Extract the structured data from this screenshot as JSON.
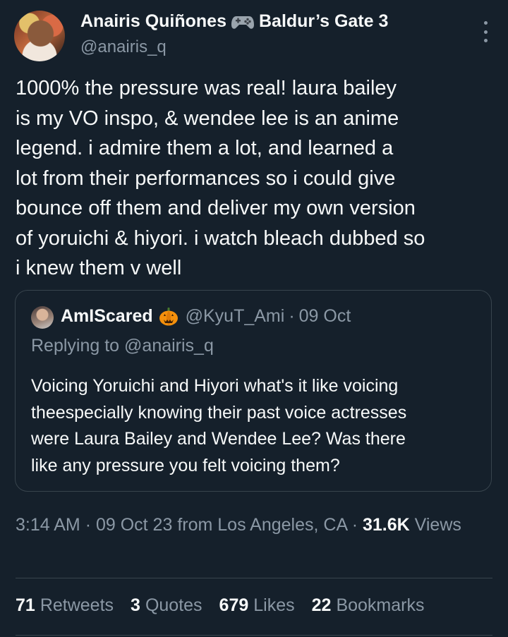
{
  "author": {
    "name": "Anairis Quiñones",
    "game_label": "Baldur’s Gate 3",
    "handle": "@anairis_q"
  },
  "tweet": {
    "text": "1000% the pressure was real! laura bailey\nis my VO inspo, & wendee lee is an anime\nlegend. i admire them a lot, and learned a\nlot from their performances so i could give\nbounce off them and deliver my own version\nof yoruichi & hiyori. i watch bleach dubbed so\ni knew them v well"
  },
  "quoted": {
    "name": "AmIScared",
    "handle": "@KyuT_Ami",
    "separator": "·",
    "date": "09 Oct",
    "replying_prefix": "Replying to",
    "replying_to": "@anairis_q",
    "text": "Voicing Yoruichi and Hiyori what's it like voicing\ntheespecially knowing their past voice actresses\nwere Laura Bailey and Wendee Lee? Was there\nlike any pressure you felt voicing them?"
  },
  "meta": {
    "time": "3:14 AM",
    "sep1": "·",
    "date": "09 Oct 23",
    "location": "from Los Angeles, CA",
    "sep2": "·",
    "views_count": "31.6K",
    "views_label": "Views"
  },
  "stats": [
    {
      "count": "71",
      "label": "Retweets"
    },
    {
      "count": "3",
      "label": "Quotes"
    },
    {
      "count": "679",
      "label": "Likes"
    },
    {
      "count": "22",
      "label": "Bookmarks"
    }
  ],
  "icons": {
    "gamepad": "gamepad-icon",
    "pumpkin": "pumpkin-icon",
    "more": "more-icon"
  },
  "colors": {
    "background": "#15202b",
    "text": "#f7f9f9",
    "secondary": "#8b98a5",
    "border": "#38444d"
  }
}
